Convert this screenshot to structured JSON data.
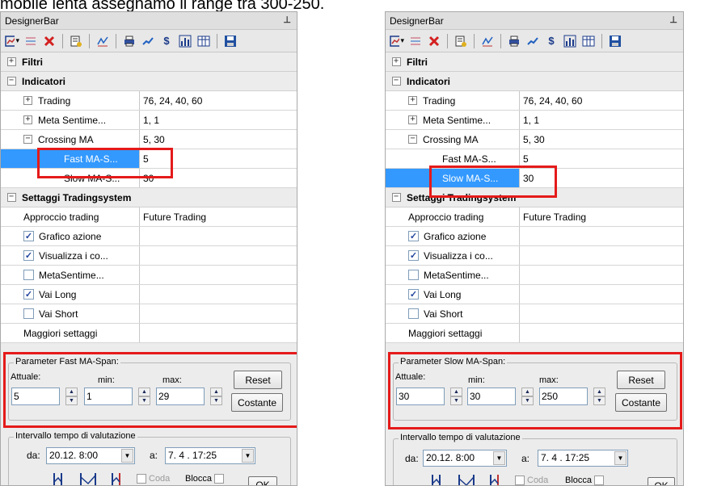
{
  "caption": "mobile lenta assegnamo il range tra 300-250.",
  "panels": [
    {
      "title": "DesignerBar",
      "categories": {
        "filtri": "Filtri",
        "indicatori": "Indicatori",
        "settaggi": "Settaggi Tradingsystem"
      },
      "indicators": [
        {
          "label": "Trading",
          "value": "76, 24, 40, 60",
          "expander": "+"
        },
        {
          "label": "Meta Sentime...",
          "value": "1, 1",
          "expander": "+"
        },
        {
          "label": "Crossing MA",
          "value": "5, 30",
          "expander": "−"
        }
      ],
      "sub_rows": [
        {
          "label": "Fast MA-S...",
          "value": "5",
          "selected": true
        },
        {
          "label": "Slow MA-S...",
          "value": "30",
          "selected": false
        }
      ],
      "settings": [
        {
          "label": "Approccio trading",
          "value": "Future Trading",
          "check": "none"
        },
        {
          "label": "Grafico azione",
          "value": "",
          "check": "checked"
        },
        {
          "label": "Visualizza i co...",
          "value": "",
          "check": "checked"
        },
        {
          "label": "MetaSentime...",
          "value": "",
          "check": "unchecked"
        },
        {
          "label": "Vai Long",
          "value": "",
          "check": "checked"
        },
        {
          "label": "Vai Short",
          "value": "",
          "check": "unchecked"
        },
        {
          "label": "Maggiori settaggi",
          "value": "",
          "check": "none"
        }
      ],
      "param": {
        "legend": "Parameter Fast MA-Span:",
        "attuale_label": "Attuale:",
        "min_label": "min:",
        "max_label": "max:",
        "attuale": "5",
        "min": "1",
        "max": "29",
        "reset": "Reset",
        "costante": "Costante"
      },
      "interval": {
        "legend": "Intervallo tempo di valutazione",
        "da_label": "da:",
        "da": "20.12.  8:00",
        "a_label": "a:",
        "a": "7. 4 . 17:25",
        "coda": "Coda",
        "blocca": "Blocca",
        "ok": "OK"
      }
    },
    {
      "title": "DesignerBar",
      "categories": {
        "filtri": "Filtri",
        "indicatori": "Indicatori",
        "settaggi": "Settaggi Tradingsystem"
      },
      "indicators": [
        {
          "label": "Trading",
          "value": "76, 24, 40, 60",
          "expander": "+"
        },
        {
          "label": "Meta Sentime...",
          "value": "1, 1",
          "expander": "+"
        },
        {
          "label": "Crossing MA",
          "value": "5, 30",
          "expander": "−"
        }
      ],
      "sub_rows": [
        {
          "label": "Fast MA-S...",
          "value": "5",
          "selected": false
        },
        {
          "label": "Slow MA-S...",
          "value": "30",
          "selected": true
        }
      ],
      "settings": [
        {
          "label": "Approccio trading",
          "value": "Future Trading",
          "check": "none"
        },
        {
          "label": "Grafico azione",
          "value": "",
          "check": "checked"
        },
        {
          "label": "Visualizza i co...",
          "value": "",
          "check": "checked"
        },
        {
          "label": "MetaSentime...",
          "value": "",
          "check": "unchecked"
        },
        {
          "label": "Vai Long",
          "value": "",
          "check": "checked"
        },
        {
          "label": "Vai Short",
          "value": "",
          "check": "unchecked"
        },
        {
          "label": "Maggiori settaggi",
          "value": "",
          "check": "none"
        }
      ],
      "param": {
        "legend": "Parameter Slow MA-Span:",
        "attuale_label": "Attuale:",
        "min_label": "min:",
        "max_label": "max:",
        "attuale": "30",
        "min": "30",
        "max": "250",
        "reset": "Reset",
        "costante": "Costante"
      },
      "interval": {
        "legend": "Intervallo tempo di valutazione",
        "da_label": "da:",
        "da": "20.12.  8:00",
        "a_label": "a:",
        "a": "7. 4 . 17:25",
        "coda": "Coda",
        "blocca": "Blocca",
        "ok": "OK"
      }
    }
  ],
  "toolbar_icons": [
    "chart-icon",
    "list-icon",
    "delete-icon",
    "properties-icon",
    "indicator-icon",
    "print-icon",
    "line-icon",
    "dollar-icon",
    "bar-chart-icon",
    "table-icon",
    "save-icon"
  ],
  "colors": {
    "selection": "#3399ff",
    "highlight_box": "#e51a1a",
    "delete_icon": "#d42020",
    "panel_bg": "#ececec"
  }
}
